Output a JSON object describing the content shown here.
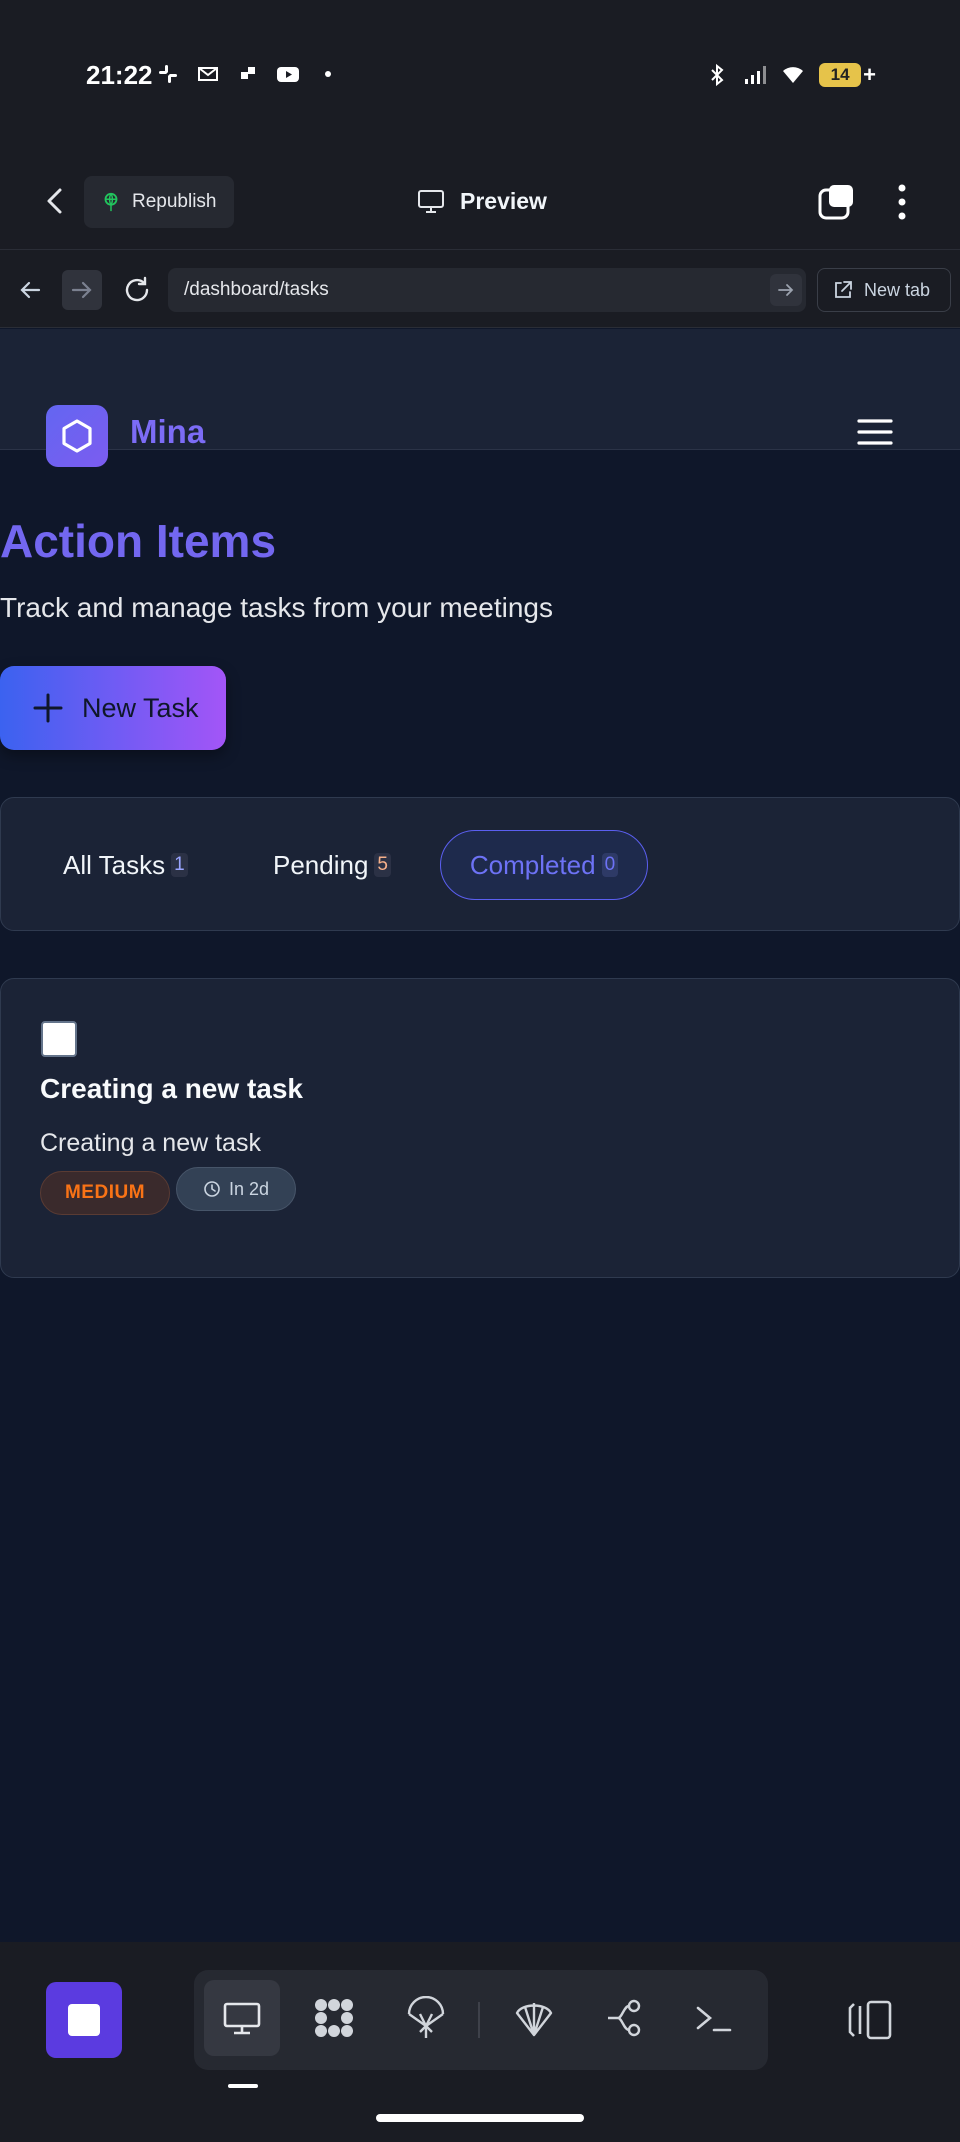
{
  "status_bar": {
    "time": "21:22",
    "battery": "14",
    "icons": [
      "slack-icon",
      "gmail-icon",
      "teams-icon",
      "youtube-icon",
      "dot-icon",
      "bluetooth-icon",
      "signal-icon",
      "wifi-icon",
      "battery-icon"
    ]
  },
  "app_header": {
    "republish_label": "Republish",
    "preview_label": "Preview"
  },
  "url_bar": {
    "url": "/dashboard/tasks",
    "new_tab_label": "New tab"
  },
  "site_nav": {
    "brand": "Mina"
  },
  "page": {
    "title": "Action Items",
    "subtitle": "Track and manage tasks from your meetings",
    "new_task_label": "New Task"
  },
  "filters": {
    "tabs": [
      {
        "label": "All Tasks",
        "count": "1"
      },
      {
        "label": "Pending",
        "count": "5"
      },
      {
        "label": "Completed",
        "count": "0"
      }
    ],
    "active": "Completed"
  },
  "tasks": [
    {
      "title": "Creating a new task",
      "description": "Creating a new task",
      "priority": "MEDIUM",
      "due": "In 2d",
      "completed": false
    }
  ],
  "colors": {
    "accent": "#7367f0",
    "page_bg": "#0f172a",
    "card_bg": "#1b2336",
    "priority_medium": "#f97316",
    "stop_button": "#5b3be0"
  }
}
